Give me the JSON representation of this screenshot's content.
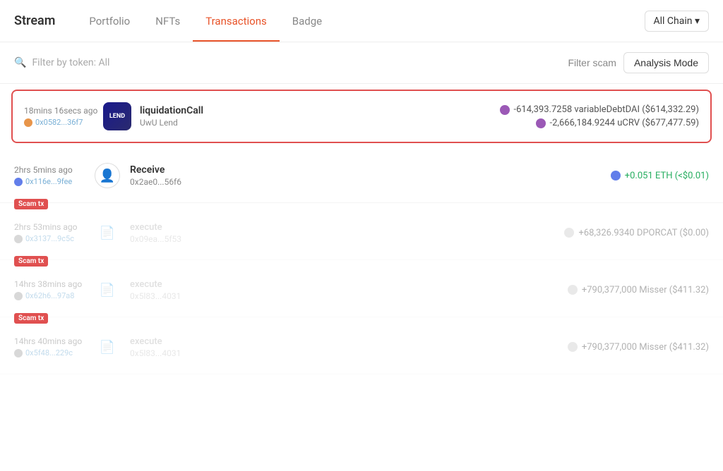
{
  "brand": "Stream",
  "nav": {
    "tabs": [
      {
        "label": "Portfolio",
        "active": false
      },
      {
        "label": "NFTs",
        "active": false
      },
      {
        "label": "Transactions",
        "active": true
      },
      {
        "label": "Badge",
        "active": false
      }
    ],
    "chain_selector": "All Chain ▾"
  },
  "filter_bar": {
    "search_placeholder": "Filter by token: All",
    "filter_scam_label": "Filter scam",
    "analysis_mode_label": "Analysis Mode"
  },
  "transactions": [
    {
      "id": "tx1",
      "highlighted": true,
      "scam": false,
      "time": "18mins 16secs ago",
      "hash": "0x0582...36f7",
      "hash_dot_color": "orange",
      "icon_type": "lend",
      "icon_label": "LEND",
      "method": "liquidationCall",
      "protocol": "UwU Lend",
      "amounts": [
        {
          "dot_color": "purple",
          "text": "-614,393.7258 variableDebtDAI ($614,332.29)"
        },
        {
          "dot_color": "purple",
          "text": "-2,666,184.9244 uCRV ($677,477.59)"
        }
      ]
    },
    {
      "id": "tx2",
      "highlighted": false,
      "scam": false,
      "time": "2hrs 5mins ago",
      "hash": "0x116e...9fee",
      "hash_dot_color": "blue-eth",
      "icon_type": "user",
      "method": "Receive",
      "protocol": "0x2ae0...56f6",
      "amounts": [
        {
          "dot_color": "eth-blue",
          "text": "+0.051 ETH (<$0.01)",
          "positive": true
        }
      ]
    },
    {
      "id": "tx3",
      "highlighted": false,
      "scam": true,
      "dimmed": true,
      "time": "2hrs 53mins ago",
      "hash": "0x3137...9c5c",
      "hash_dot_color": "gray",
      "icon_type": "doc",
      "method": "execute",
      "protocol": "0x09ea...5f53",
      "amounts": [
        {
          "dot_color": "gray",
          "text": "+68,326.9340 DPORCAT ($0.00)"
        }
      ]
    },
    {
      "id": "tx4",
      "highlighted": false,
      "scam": true,
      "dimmed": true,
      "time": "14hrs 38mins ago",
      "hash": "0x62h6...97a8",
      "hash_dot_color": "gray",
      "icon_type": "doc",
      "method": "execute",
      "protocol": "0x5l83...4031",
      "amounts": [
        {
          "dot_color": "gray",
          "text": "+790,377,000 Misser ($411.32)"
        }
      ]
    },
    {
      "id": "tx5",
      "highlighted": false,
      "scam": true,
      "dimmed": true,
      "time": "14hrs 40mins ago",
      "hash": "0x5f48...229c",
      "hash_dot_color": "gray",
      "icon_type": "doc",
      "method": "execute",
      "protocol": "0x5l83...4031",
      "amounts": [
        {
          "dot_color": "gray",
          "text": "+790,377,000 Misser ($411.32)"
        }
      ]
    }
  ]
}
